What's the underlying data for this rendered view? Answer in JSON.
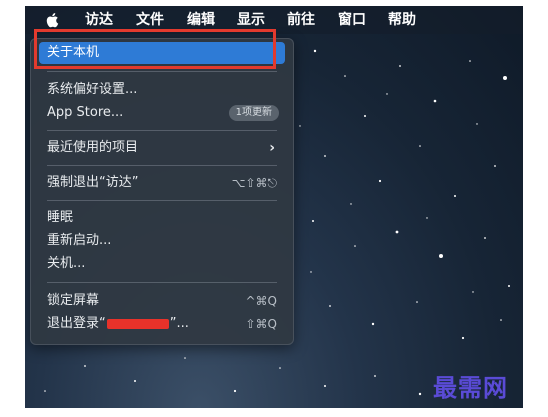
{
  "menubar": {
    "apple_icon": "apple-logo-icon",
    "items": [
      "访达",
      "文件",
      "编辑",
      "显示",
      "前往",
      "窗口",
      "帮助"
    ]
  },
  "apple_menu": {
    "about": "关于本机",
    "system_prefs": "系统偏好设置...",
    "app_store": "App Store...",
    "app_store_badge": "1项更新",
    "recent_items": "最近使用的项目",
    "recent_chevron": "›",
    "force_quit": "强制退出“访达”",
    "force_quit_shortcut": "⌥⇧⌘⎋",
    "sleep": "睡眠",
    "restart": "重新启动...",
    "shutdown": "关机...",
    "lock_screen": "锁定屏幕",
    "lock_shortcut": "^⌘Q",
    "logout_prefix": "退出登录“",
    "logout_suffix": "”...",
    "logout_shortcut": "⇧⌘Q"
  },
  "colors": {
    "highlight": "#2e7bd6",
    "annotation_box": "#e23a2e"
  },
  "watermark": "最需网"
}
